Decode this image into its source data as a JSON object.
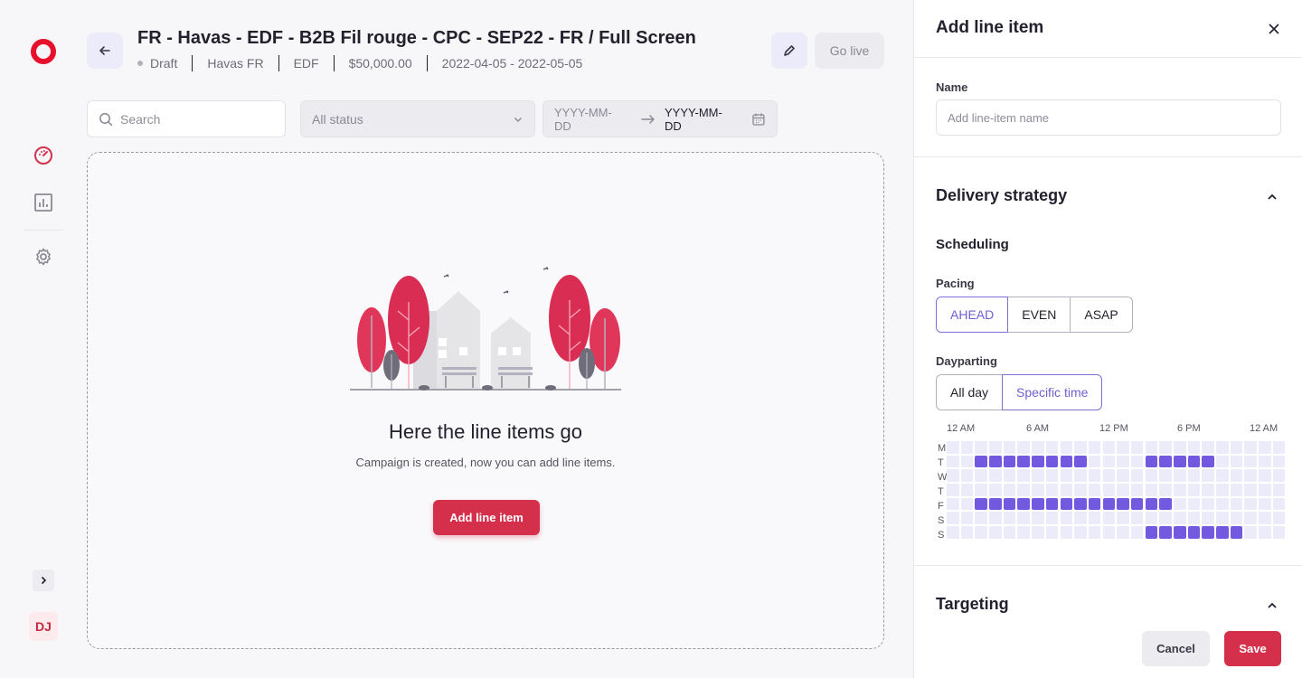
{
  "sidebar": {
    "items": [
      {
        "icon": "dashboard-gauge-icon"
      },
      {
        "icon": "bar-chart-icon"
      },
      {
        "icon": "gear-icon"
      }
    ],
    "avatar_initials": "DJ"
  },
  "header": {
    "title": "FR - Havas - EDF - B2B Fil rouge - CPC - SEP22 - FR / Full Screen",
    "status": "Draft",
    "agency": "Havas FR",
    "advertiser": "EDF",
    "budget": "$50,000.00",
    "dates": "2022-04-05 - 2022-05-05",
    "go_live_label": "Go live"
  },
  "filters": {
    "search_placeholder": "Search",
    "status_value": "All status",
    "date_start_placeholder": "YYYY-MM-DD",
    "date_end_placeholder": "YYYY-MM-DD"
  },
  "empty_state": {
    "title": "Here the line items go",
    "subtitle": "Campaign is created, now you can add line items.",
    "button_label": "Add line item"
  },
  "panel": {
    "title": "Add line item",
    "name_label": "Name",
    "name_placeholder": "Add line-item name",
    "delivery_title": "Delivery strategy",
    "scheduling_title": "Scheduling",
    "pacing_label": "Pacing",
    "pacing_options": [
      "AHEAD",
      "EVEN",
      "ASAP"
    ],
    "pacing_selected": "AHEAD",
    "dayparting_label": "Dayparting",
    "dayparting_options": [
      "All day",
      "Specific time"
    ],
    "dayparting_selected": "Specific time",
    "hour_labels": [
      "12 AM",
      "6 AM",
      "12 PM",
      "6 PM",
      "12 AM"
    ],
    "day_labels": [
      "M",
      "T",
      "W",
      "T",
      "F",
      "S",
      "S"
    ],
    "schedule_grid": [
      [
        0,
        0,
        0,
        0,
        0,
        0,
        0,
        0,
        0,
        0,
        0,
        0,
        0,
        0,
        0,
        0,
        0,
        0,
        0,
        0,
        0,
        0,
        0,
        0
      ],
      [
        0,
        0,
        1,
        1,
        1,
        1,
        1,
        1,
        1,
        1,
        0,
        0,
        0,
        0,
        1,
        1,
        1,
        1,
        1,
        0,
        0,
        0,
        0,
        0
      ],
      [
        0,
        0,
        0,
        0,
        0,
        0,
        0,
        0,
        0,
        0,
        0,
        0,
        0,
        0,
        0,
        0,
        0,
        0,
        0,
        0,
        0,
        0,
        0,
        0
      ],
      [
        0,
        0,
        0,
        0,
        0,
        0,
        0,
        0,
        0,
        0,
        0,
        0,
        0,
        0,
        0,
        0,
        0,
        0,
        0,
        0,
        0,
        0,
        0,
        0
      ],
      [
        0,
        0,
        1,
        1,
        1,
        1,
        1,
        1,
        1,
        1,
        1,
        1,
        1,
        1,
        1,
        1,
        0,
        0,
        0,
        0,
        0,
        0,
        0,
        0
      ],
      [
        0,
        0,
        0,
        0,
        0,
        0,
        0,
        0,
        0,
        0,
        0,
        0,
        0,
        0,
        0,
        0,
        0,
        0,
        0,
        0,
        0,
        0,
        0,
        0
      ],
      [
        0,
        0,
        0,
        0,
        0,
        0,
        0,
        0,
        0,
        0,
        0,
        0,
        0,
        0,
        1,
        1,
        1,
        1,
        1,
        1,
        1,
        0,
        0,
        0
      ]
    ],
    "targeting_title": "Targeting",
    "cancel_label": "Cancel",
    "save_label": "Save"
  },
  "colors": {
    "brand_red": "#e8112d",
    "primary_button": "#d4304c",
    "accent_purple": "#7259e0"
  }
}
